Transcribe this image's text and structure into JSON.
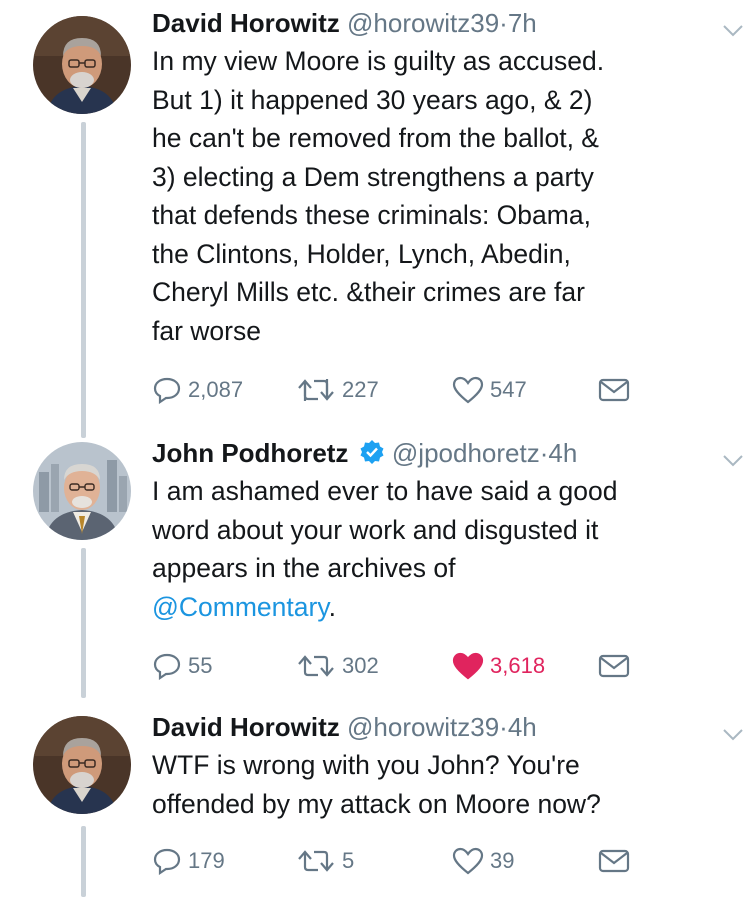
{
  "colors": {
    "text": "#14171a",
    "secondary": "#657786",
    "link": "#1b95e0",
    "like_active": "#e0245e",
    "thread_line": "#c9d1d8",
    "verified": "#1da1f2"
  },
  "tweets": [
    {
      "name": "David Horowitz",
      "handle": "@horowitz39",
      "dot": "·",
      "time": "7h",
      "verified": false,
      "text_lines": [
        "In my view Moore is guilty as accused.",
        "But 1) it happened 30 years ago, & 2)",
        "he can't be removed from the ballot, &",
        "3) electing a Dem strengthens a party",
        "that defends these criminals: Obama,",
        "the Clintons, Holder, Lynch, Abedin,",
        "Cheryl Mills etc. &their crimes are far",
        "far worse"
      ],
      "replies": "2,087",
      "retweets": "227",
      "likes": "547",
      "liked": false
    },
    {
      "name": "John Podhoretz",
      "handle": "@jpodhoretz",
      "dot": "·",
      "time": "4h",
      "verified": true,
      "text_lines": [
        "I am ashamed ever to have said a good",
        "word about your work and disgusted it",
        "appears in the archives of"
      ],
      "mention": "@Commentary",
      "mention_suffix": ".",
      "replies": "55",
      "retweets": "302",
      "likes": "3,618",
      "liked": true
    },
    {
      "name": "David Horowitz",
      "handle": "@horowitz39",
      "dot": "·",
      "time": "4h",
      "verified": false,
      "text_lines": [
        "WTF is wrong with you John? You're",
        "offended by my attack on Moore now?"
      ],
      "replies": "179",
      "retweets": "5",
      "likes": "39",
      "liked": false
    }
  ],
  "icons": {
    "reply": "reply-icon",
    "retweet": "retweet-icon",
    "like": "heart-icon",
    "message": "envelope-icon",
    "caret": "chevron-down-icon",
    "verified": "verified-badge-icon"
  }
}
